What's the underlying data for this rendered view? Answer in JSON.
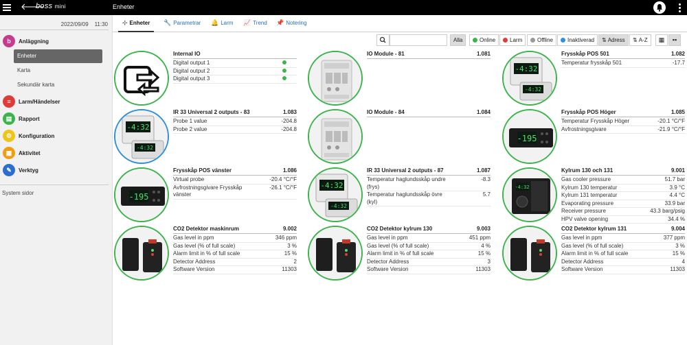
{
  "topbar": {
    "logo": "boss",
    "logo_suffix": "mini",
    "title": "Enheter"
  },
  "sidebar": {
    "date": "2022/09/09",
    "time": "11:30",
    "groups": [
      {
        "label": "Anläggning",
        "color": "#c83a8c",
        "icon": "b"
      },
      {
        "label": "Larm/Händelser",
        "color": "#e03b3b",
        "icon": "≡"
      },
      {
        "label": "Rapport",
        "color": "#3cb44b",
        "icon": "▤"
      },
      {
        "label": "Konfiguration",
        "color": "#f0c419",
        "icon": "⚙"
      },
      {
        "label": "Aktivitet",
        "color": "#f39c12",
        "icon": "▦"
      },
      {
        "label": "Verktyg",
        "color": "#2a6fd0",
        "icon": "✎"
      }
    ],
    "subitems": [
      "Enheter",
      "Karta",
      "Sekundär karta"
    ],
    "system": "System sidor"
  },
  "tabs": [
    "Enheter",
    "Parametrar",
    "Larm",
    "Trend",
    "Notering"
  ],
  "filters": {
    "all": "Alla",
    "online": "Online",
    "alarm": "Larm",
    "offline": "Offline",
    "inactive": "Inaktiverad",
    "sort_address": "Adress",
    "sort_az": "A-Z",
    "colors": {
      "online": "#3cb44b",
      "alarm": "#e03b3b",
      "offline": "#999999",
      "inactive": "#2f8fdc"
    }
  },
  "devices": [
    {
      "name": "Internal IO",
      "id": "",
      "img": "io",
      "rows": [
        [
          "Digital output 1",
          ""
        ],
        [
          "Digital output 2",
          ""
        ],
        [
          "Digital output 3",
          ""
        ]
      ]
    },
    {
      "name": "IO Module - 81",
      "id": "1.081",
      "img": "module",
      "rows": []
    },
    {
      "name": "Frysskåp POS 501",
      "id": "1.082",
      "img": "controller",
      "rows": [
        [
          "Temperatur frysskåp 501",
          "-17.7"
        ]
      ]
    },
    {
      "name": "IR 33 Universal 2 outputs - 83",
      "id": "1.083",
      "img": "controller",
      "rows": [
        [
          "Probe 1 value",
          "-204.8"
        ],
        [
          "Probe 2 value",
          "-204.8"
        ]
      ]
    },
    {
      "name": "IO Module - 84",
      "id": "1.084",
      "img": "module",
      "rows": []
    },
    {
      "name": "Frysskåp POS Höger",
      "id": "1.085",
      "img": "panel",
      "rows": [
        [
          "Temperatur Frysskåp Höger",
          "-20.1 °C/°F"
        ],
        [
          "Avfrostningsgivare",
          "-21.9 °C/°F"
        ]
      ]
    },
    {
      "name": "Frysskåp POS vänster",
      "id": "1.086",
      "img": "panel",
      "rows": [
        [
          "Virtual probe",
          "-20.4 °C/°F"
        ],
        [
          "Avfrostningsgivare Frysskåp vänster",
          "-26.1 °C/°F"
        ]
      ]
    },
    {
      "name": "IR 33 Universal 2 outputs - 87",
      "id": "1.087",
      "img": "controller",
      "rows": [
        [
          "Temperatur haglundsskåp undre (frys)",
          "-8.3"
        ],
        [
          "Temperatur haglundsskåp övre (kyl)",
          "5.7"
        ]
      ]
    },
    {
      "name": "Kylrum 130 och 131",
      "id": "9.001",
      "img": "kylrum",
      "rows": [
        [
          "Gas cooler pressure",
          "51.7 bar"
        ],
        [
          "Kylrum 130 temperatur",
          "3.9 °C"
        ],
        [
          "Kylrum 131 temperatur",
          "4.4 °C"
        ],
        [
          "Evaporating pressure",
          "33.9 bar"
        ],
        [
          "Receiver pressure",
          "43.3 barg/psig"
        ],
        [
          "HPV valve opening",
          "34.4 %"
        ]
      ]
    },
    {
      "name": "CO2 Detektor maskinrum",
      "id": "9.002",
      "img": "detector",
      "rows": [
        [
          "Gas level in ppm",
          "346 ppm"
        ],
        [
          "Gas level (% of full scale)",
          "3 %"
        ],
        [
          "Alarm limit in % of full scale",
          "15 %"
        ],
        [
          "Detector Address",
          "2"
        ],
        [
          "Software Version",
          "11303"
        ]
      ]
    },
    {
      "name": "CO2 Detektor kylrum 130",
      "id": "9.003",
      "img": "detector",
      "rows": [
        [
          "Gas level in ppm",
          "451 ppm"
        ],
        [
          "Gas level (% of full scale)",
          "4 %"
        ],
        [
          "Alarm limit in % of full scale",
          "15 %"
        ],
        [
          "Detector Address",
          "3"
        ],
        [
          "Software Version",
          "11303"
        ]
      ]
    },
    {
      "name": "CO2 Detektor kylrum 131",
      "id": "9.004",
      "img": "detector",
      "rows": [
        [
          "Gas level in ppm",
          "377 ppm"
        ],
        [
          "Gas level (% of full scale)",
          "3 %"
        ],
        [
          "Alarm limit in % of full scale",
          "15 %"
        ],
        [
          "Detector Address",
          "4"
        ],
        [
          "Software Version",
          "11303"
        ]
      ]
    }
  ],
  "screen_text": {
    "controller": "-4:32",
    "panel": "-195",
    "kylrum": "-4:32"
  }
}
